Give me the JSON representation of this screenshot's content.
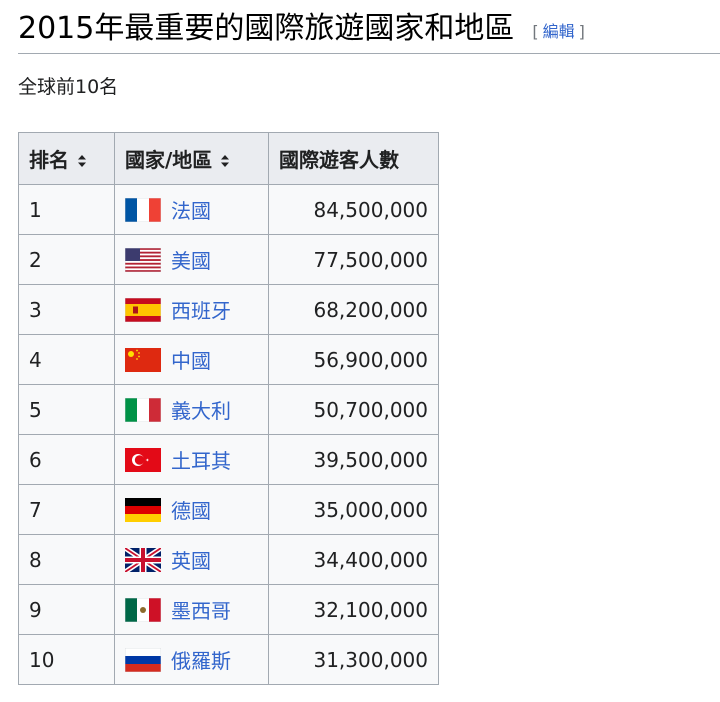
{
  "section": {
    "title": "2015年最重要的國際旅遊國家和地區",
    "edit_open": "[",
    "edit_label": "編輯",
    "edit_close": "]"
  },
  "subtitle": "全球前10名",
  "table": {
    "headers": {
      "rank": "排名",
      "country": "國家/地區",
      "visitors": "國際遊客人數"
    },
    "rows": [
      {
        "rank": "1",
        "country": "法國",
        "flag": "france-flag-icon",
        "visitors": "84,500,000"
      },
      {
        "rank": "2",
        "country": "美國",
        "flag": "usa-flag-icon",
        "visitors": "77,500,000"
      },
      {
        "rank": "3",
        "country": "西班牙",
        "flag": "spain-flag-icon",
        "visitors": "68,200,000"
      },
      {
        "rank": "4",
        "country": "中國",
        "flag": "china-flag-icon",
        "visitors": "56,900,000"
      },
      {
        "rank": "5",
        "country": "義大利",
        "flag": "italy-flag-icon",
        "visitors": "50,700,000"
      },
      {
        "rank": "6",
        "country": "土耳其",
        "flag": "turkey-flag-icon",
        "visitors": "39,500,000"
      },
      {
        "rank": "7",
        "country": "德國",
        "flag": "germany-flag-icon",
        "visitors": "35,000,000"
      },
      {
        "rank": "8",
        "country": "英國",
        "flag": "uk-flag-icon",
        "visitors": "34,400,000"
      },
      {
        "rank": "9",
        "country": "墨西哥",
        "flag": "mexico-flag-icon",
        "visitors": "32,100,000"
      },
      {
        "rank": "10",
        "country": "俄羅斯",
        "flag": "russia-flag-icon",
        "visitors": "31,300,000"
      }
    ]
  },
  "colors": {
    "link": "#3366cc",
    "header_bg": "#eaecf0",
    "cell_bg": "#f8f9fa",
    "border": "#a2a9b1"
  }
}
